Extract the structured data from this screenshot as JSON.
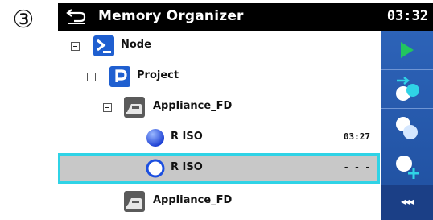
{
  "step_marker": "③",
  "header": {
    "title": "Memory Organizer",
    "time": "03:32",
    "back_icon": "back-arrow-icon"
  },
  "tree": {
    "rows": [
      {
        "label": "Node",
        "icon": "node-prompt-icon",
        "level": 0,
        "expander": "collapse"
      },
      {
        "label": "Project",
        "icon": "project-icon",
        "level": 1,
        "expander": "collapse"
      },
      {
        "label": "Appliance_FD",
        "icon": "appliance-icon",
        "level": 2,
        "expander": "collapse"
      },
      {
        "label": "R ISO",
        "icon": "measurement-filled-icon",
        "level": 3,
        "time": "03:27"
      },
      {
        "label": "R ISO",
        "icon": "measurement-empty-icon",
        "level": 3,
        "time": "- - -",
        "selected": true
      },
      {
        "label": "Appliance_FD",
        "icon": "appliance-icon",
        "level": 2
      }
    ]
  },
  "side_panel": {
    "buttons": [
      {
        "name": "start-button",
        "icon": "play-icon"
      },
      {
        "name": "clone-measurement-button",
        "icon": "clone-icon"
      },
      {
        "name": "copy-measurement-button",
        "icon": "copy-icon"
      },
      {
        "name": "add-measurement-button",
        "icon": "add-measurement-icon"
      },
      {
        "name": "more-options-button",
        "label": "◂◂◂"
      }
    ]
  },
  "colors": {
    "title_bg": "#000000",
    "selection_outline": "#2fd3e6",
    "selection_bg": "#c8c8c8",
    "panel_blue": "#2d63b8",
    "play_green": "#22c55e",
    "accent_cyan": "#2fd3e6"
  }
}
